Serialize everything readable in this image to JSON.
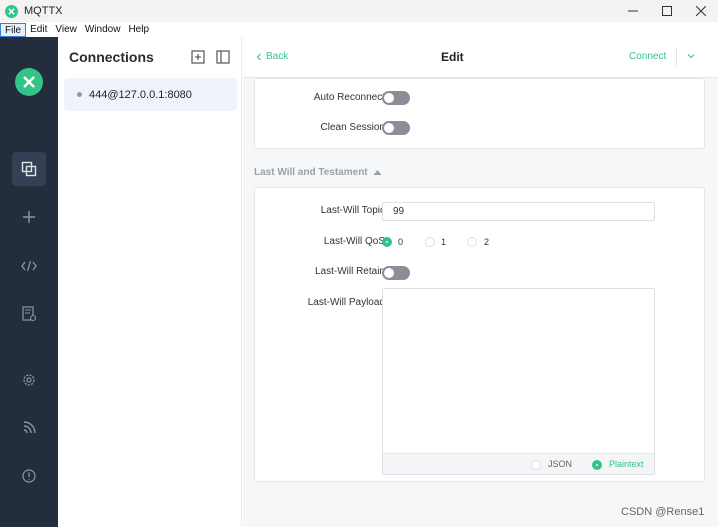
{
  "window": {
    "title": "MQTTX",
    "controls": [
      "minimize",
      "maximize",
      "close"
    ]
  },
  "menu": {
    "items": [
      "File",
      "Edit",
      "View",
      "Window",
      "Help"
    ],
    "active": "File"
  },
  "sidebar": {
    "logo_icon": "mqttx-logo-icon",
    "items": [
      {
        "icon": "connections-icon",
        "active": true
      },
      {
        "icon": "plus-icon",
        "active": false
      },
      {
        "icon": "code-icon",
        "active": false
      },
      {
        "icon": "log-icon",
        "active": false
      },
      {
        "icon": "settings-icon",
        "active": false
      },
      {
        "icon": "feed-icon",
        "active": false
      },
      {
        "icon": "info-icon",
        "active": false
      }
    ]
  },
  "connections": {
    "title": "Connections",
    "items": [
      {
        "label": "444@127.0.0.1:8080",
        "status_color": "#999999"
      }
    ]
  },
  "editor": {
    "back_label": "Back",
    "title": "Edit",
    "connect_label": "Connect",
    "auto_reconnect_label": "Auto Reconnect",
    "auto_reconnect": false,
    "clean_session_label": "Clean Session",
    "clean_session": false,
    "lwt_section_title": "Last Will and Testament",
    "lwt_topic_label": "Last-Will Topic",
    "lwt_topic_value": "99",
    "lwt_qos_label": "Last-Will QoS",
    "lwt_qos_options": [
      "0",
      "1",
      "2"
    ],
    "lwt_qos_selected": "0",
    "lwt_retain_label": "Last-Will Retain",
    "lwt_retain": false,
    "lwt_payload_label": "Last-Will Payload",
    "lwt_payload_value": "",
    "payload_format_options": [
      "JSON",
      "Plaintext"
    ],
    "payload_format_selected": "Plaintext"
  },
  "watermark": "CSDN @Rense1",
  "colors": {
    "accent": "#34c388",
    "sidebar_bg": "#232d3b",
    "toggle_off": "#8a8f97"
  }
}
